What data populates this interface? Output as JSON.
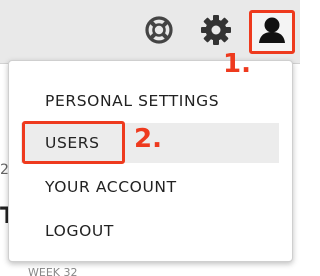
{
  "toolbar": {
    "help_icon": "lifebuoy-icon",
    "settings_icon": "gear-icon",
    "user_icon": "user-silhouette-icon"
  },
  "annotations": {
    "step1": "1.",
    "step2": "2.",
    "color": "#ee3a1e"
  },
  "background": {
    "fragment_a": "2",
    "fragment_b": "T",
    "fragment_c": "WEEK 32"
  },
  "menu": {
    "items": [
      {
        "label": "PERSONAL SETTINGS"
      },
      {
        "label": "USERS"
      },
      {
        "label": "YOUR ACCOUNT"
      },
      {
        "label": "LOGOUT"
      }
    ]
  }
}
